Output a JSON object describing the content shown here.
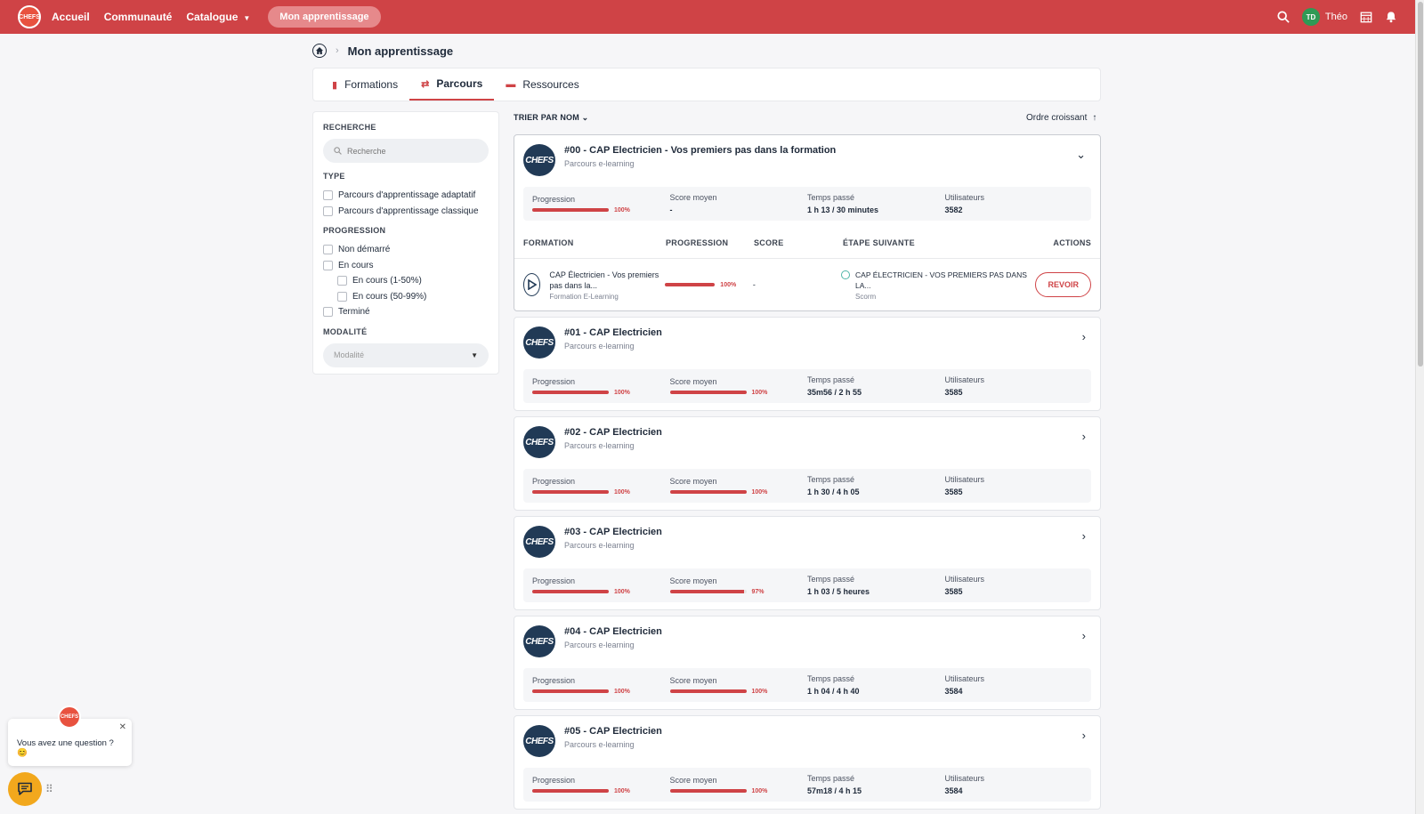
{
  "nav": {
    "logo_text": "CHEFS",
    "links": [
      "Accueil",
      "Communauté",
      "Catalogue"
    ],
    "active_pill": "Mon apprentissage",
    "user_initials": "TD",
    "user_name": "Théo"
  },
  "breadcrumb": {
    "title": "Mon apprentissage"
  },
  "tabs": [
    {
      "label": "Formations",
      "icon": "book-icon"
    },
    {
      "label": "Parcours",
      "icon": "route-icon",
      "active": true
    },
    {
      "label": "Ressources",
      "icon": "folder-icon"
    }
  ],
  "filters": {
    "search_heading": "RECHERCHE",
    "search_placeholder": "Recherche",
    "type_heading": "TYPE",
    "type_options": [
      "Parcours d'apprentissage adaptatif",
      "Parcours d'apprentissage classique"
    ],
    "progress_heading": "PROGRESSION",
    "progress_options": [
      "Non démarré",
      "En cours",
      "En cours (1-50%)",
      "En cours (50-99%)",
      "Terminé"
    ],
    "modality_heading": "MODALITÉ",
    "modality_placeholder": "Modalité"
  },
  "sort": {
    "left": "TRIER PAR NOM",
    "right": "Ordre croissant"
  },
  "stat_labels": {
    "progress": "Progression",
    "score": "Score moyen",
    "time": "Temps passé",
    "users": "Utilisateurs"
  },
  "cards": [
    {
      "title": "#00 - CAP Electricien - Vos premiers pas dans la formation",
      "subtitle": "Parcours e-learning",
      "progress": 100,
      "progress_label": "100%",
      "score": "-",
      "time": "1 h 13 / 30 minutes",
      "users": "3582",
      "expanded": true
    },
    {
      "title": "#01 - CAP Electricien",
      "subtitle": "Parcours e-learning",
      "progress": 100,
      "progress_label": "100%",
      "score": 100,
      "score_label": "100%",
      "time": "35m56 / 2 h 55",
      "users": "3585"
    },
    {
      "title": "#02 - CAP Electricien",
      "subtitle": "Parcours e-learning",
      "progress": 100,
      "progress_label": "100%",
      "score": 100,
      "score_label": "100%",
      "time": "1 h 30 / 4 h 05",
      "users": "3585"
    },
    {
      "title": "#03 - CAP Electricien",
      "subtitle": "Parcours e-learning",
      "progress": 100,
      "progress_label": "100%",
      "score": 97,
      "score_label": "97%",
      "time": "1 h 03 / 5 heures",
      "users": "3585"
    },
    {
      "title": "#04 - CAP Electricien",
      "subtitle": "Parcours e-learning",
      "progress": 100,
      "progress_label": "100%",
      "score": 100,
      "score_label": "100%",
      "time": "1 h 04 / 4 h 40",
      "users": "3584"
    },
    {
      "title": "#05 - CAP Electricien",
      "subtitle": "Parcours e-learning",
      "progress": 100,
      "progress_label": "100%",
      "score": 100,
      "score_label": "100%",
      "time": "57m18 / 4 h 15",
      "users": "3584"
    }
  ],
  "card_logo_text": "CHEFS",
  "table": {
    "headers": [
      "FORMATION",
      "PROGRESSION",
      "SCORE",
      "ÉTAPE SUIVANTE",
      "ACTIONS"
    ],
    "row": {
      "title": "CAP Électricien - Vos premiers pas dans la...",
      "subtitle": "Formation E-Learning",
      "progress": 100,
      "progress_label": "100%",
      "score": "-",
      "next_title": "CAP ÉLECTRICIEN - VOS PREMIERS PAS DANS LA...",
      "next_sub": "Scorm",
      "action": "REVOIR"
    }
  },
  "chat": {
    "message": "Vous avez une question ? 😊",
    "logo_text": "CHEFS"
  }
}
